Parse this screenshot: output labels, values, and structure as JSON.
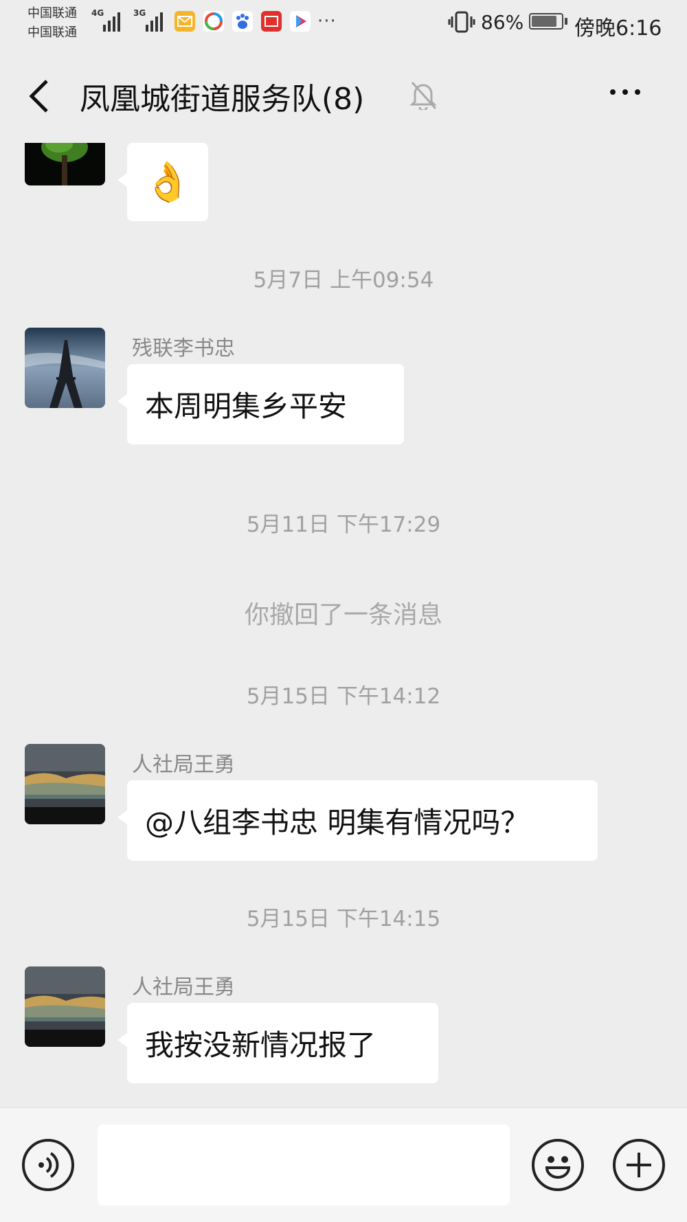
{
  "status_bar": {
    "carrier_1": "中国联通",
    "carrier_2": "中国联通",
    "network_1": "4G",
    "network_2": "3G",
    "battery_percent": "86%",
    "battery_level": 0.86,
    "time": "傍晚6:16",
    "app_icons": [
      "mail-icon",
      "browser-icon",
      "baidu-icon",
      "netease-icon",
      "youku-icon"
    ],
    "overflow": "···"
  },
  "header": {
    "title": "凤凰城街道服务队(8)"
  },
  "messages": [
    {
      "type": "emoji",
      "content": "👌"
    },
    {
      "type": "time",
      "text": "5月7日 上午09:54"
    },
    {
      "type": "text",
      "sender": "残联李书忠",
      "text": "本周明集乡平安"
    },
    {
      "type": "time",
      "text": "5月11日 下午17:29"
    },
    {
      "type": "notice",
      "text": "你撤回了一条消息"
    },
    {
      "type": "time",
      "text": "5月15日 下午14:12"
    },
    {
      "type": "text",
      "sender": "人社局王勇",
      "text": "@八组李书忠  明集有情况吗？"
    },
    {
      "type": "time",
      "text": "5月15日 下午14:15"
    },
    {
      "type": "text",
      "sender": "人社局王勇",
      "text": "我按没新情况报了"
    }
  ],
  "input_bar": {
    "text_value": ""
  },
  "colors": {
    "chat_background": "#ededed",
    "bubble": "#ffffff",
    "meta_text": "#a0a0a0"
  }
}
